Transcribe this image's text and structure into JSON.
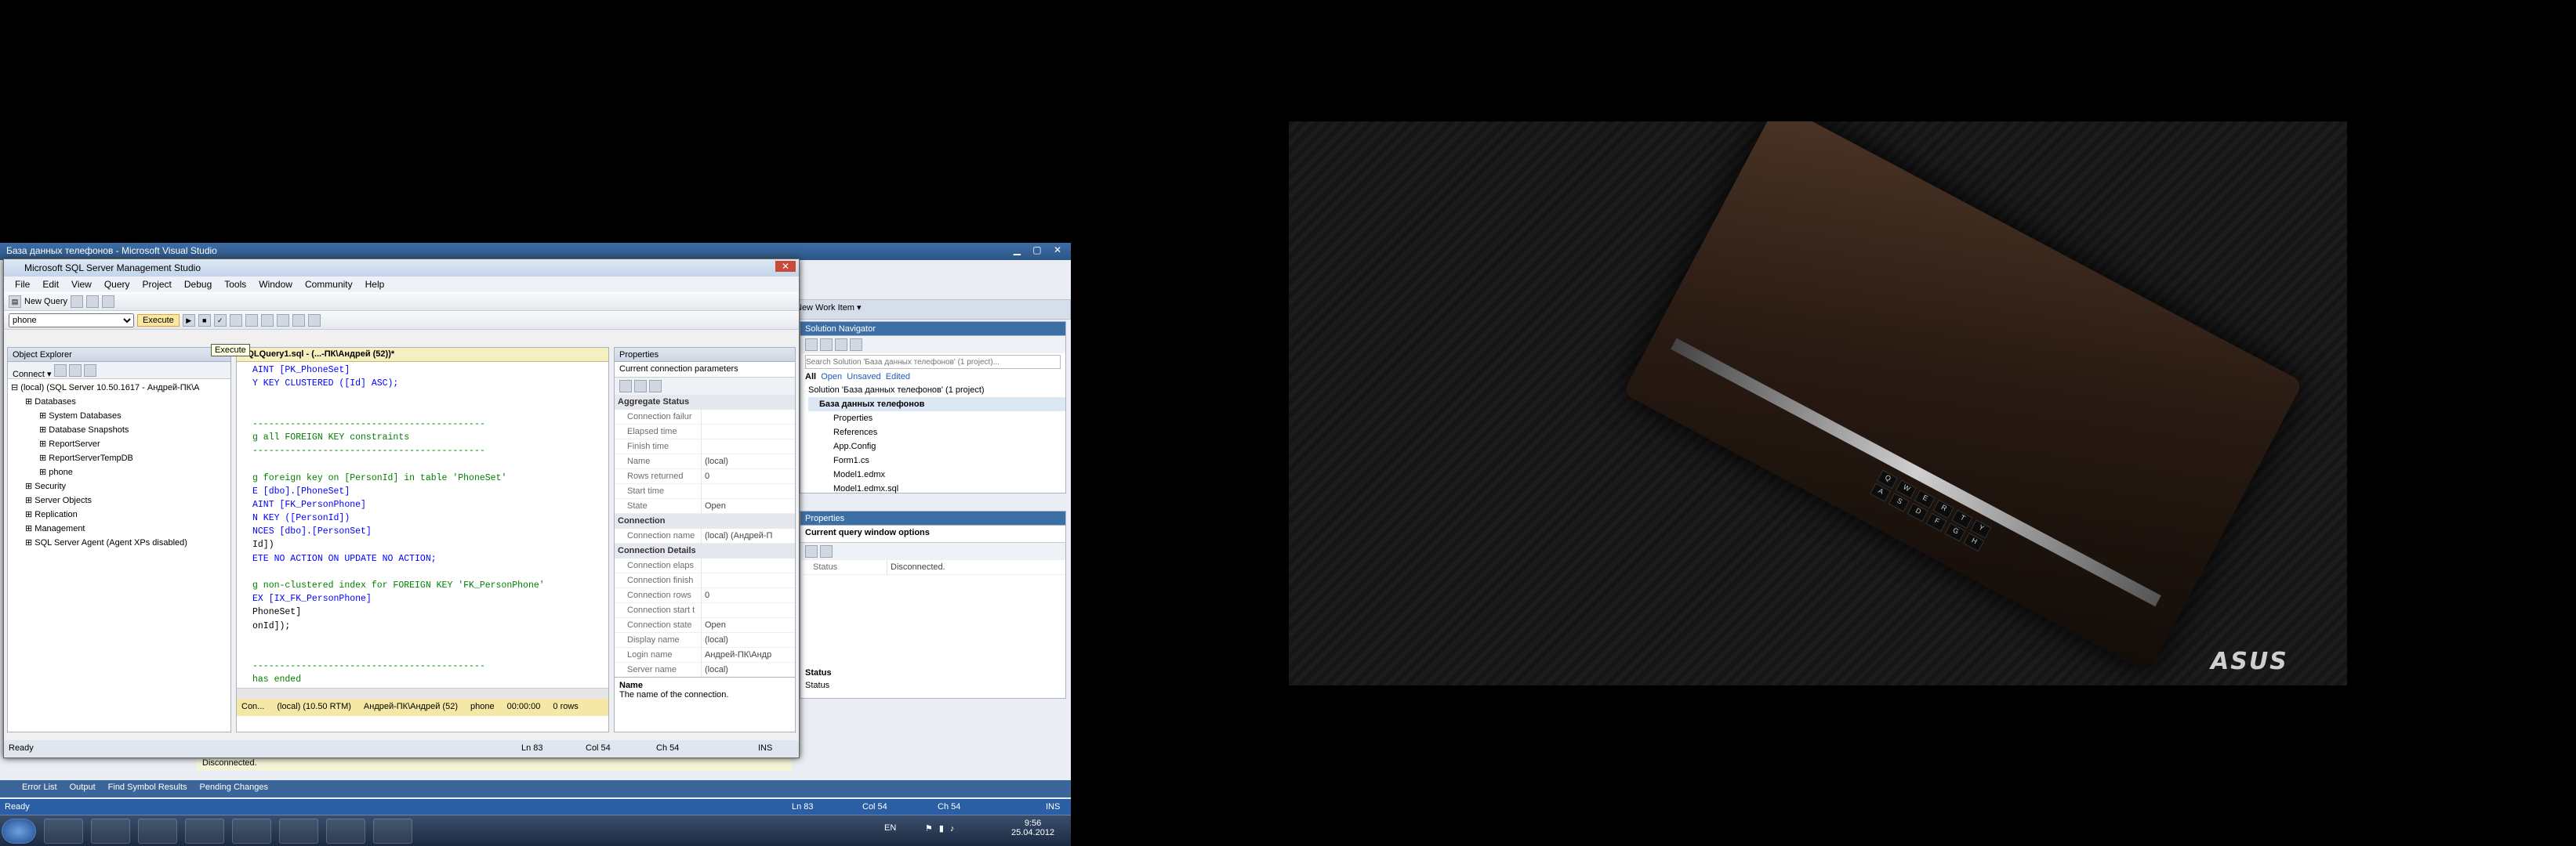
{
  "wallpaper": {
    "brand": "ASUS"
  },
  "vs": {
    "title": "База данных телефонов - Microsoft Visual Studio",
    "team_item": "New Work Item ▾",
    "bottom_tabs": [
      "Error List",
      "Output",
      "Find Symbol Results",
      "Pending Changes"
    ],
    "status": {
      "ready": "Ready",
      "ln": "Ln 83",
      "col": "Col 54",
      "ch": "Ch 54",
      "ins": "INS"
    },
    "disconnected": "Disconnected.",
    "status_label": "Status",
    "status_label2": "Status"
  },
  "solution": {
    "header": "Solution Navigator",
    "search_placeholder": "Search Solution 'База данных телефонов' (1 project)...",
    "filters": [
      "All",
      "Open",
      "Unsaved",
      "Edited"
    ],
    "items": [
      "Solution 'База данных телефонов' (1 project)",
      "База данных телефонов",
      "Properties",
      "References",
      "App.Config",
      "Form1.cs",
      "Model1.edmx",
      "Model1.edmx.sql"
    ]
  },
  "vs_properties": {
    "header": "Properties",
    "object": "Current query window options",
    "rows": [
      {
        "k": "Status",
        "v": "Disconnected."
      }
    ]
  },
  "ssms": {
    "title": "Microsoft SQL Server Management Studio",
    "menu": [
      "File",
      "Edit",
      "View",
      "Query",
      "Project",
      "Debug",
      "Tools",
      "Window",
      "Community",
      "Help"
    ],
    "new_query": "New Query",
    "database": "phone",
    "execute": "Execute",
    "tooltip": "Execute"
  },
  "object_explorer": {
    "header": "Object Explorer",
    "connect": "Connect ▾",
    "nodes": [
      {
        "label": "(local) (SQL Server 10.50.1617 - Андрей-ПК\\А",
        "indent": 0
      },
      {
        "label": "Databases",
        "indent": 1
      },
      {
        "label": "System Databases",
        "indent": 2
      },
      {
        "label": "Database Snapshots",
        "indent": 2
      },
      {
        "label": "ReportServer",
        "indent": 2
      },
      {
        "label": "ReportServerTempDB",
        "indent": 2
      },
      {
        "label": "phone",
        "indent": 2
      },
      {
        "label": "Security",
        "indent": 1
      },
      {
        "label": "Server Objects",
        "indent": 1
      },
      {
        "label": "Replication",
        "indent": 1
      },
      {
        "label": "Management",
        "indent": 1
      },
      {
        "label": "SQL Server Agent (Agent XPs disabled)",
        "indent": 1
      }
    ]
  },
  "editor": {
    "tab": "SQLQuery1.sql - (...-ПК\\Андрей (52))*",
    "lines": [
      {
        "t": "AINT [PK_PhoneSet]",
        "c": "blue"
      },
      {
        "t": "Y KEY CLUSTERED ([Id] ASC);",
        "c": "blue"
      },
      {
        "t": "",
        "c": ""
      },
      {
        "t": "",
        "c": ""
      },
      {
        "t": "-------------------------------------------",
        "c": "green"
      },
      {
        "t": "g all FOREIGN KEY constraints",
        "c": "green"
      },
      {
        "t": "-------------------------------------------",
        "c": "green"
      },
      {
        "t": "",
        "c": ""
      },
      {
        "t": "g foreign key on [PersonId] in table 'PhoneSet'",
        "c": "green"
      },
      {
        "t": "E [dbo].[PhoneSet]",
        "c": "blue"
      },
      {
        "t": "AINT [FK_PersonPhone]",
        "c": "blue"
      },
      {
        "t": "N KEY ([PersonId])",
        "c": "blue"
      },
      {
        "t": "NCES [dbo].[PersonSet]",
        "c": "blue"
      },
      {
        "t": "Id])",
        "c": ""
      },
      {
        "t": "ETE NO ACTION ON UPDATE NO ACTION;",
        "c": "blue"
      },
      {
        "t": "",
        "c": ""
      },
      {
        "t": "g non-clustered index for FOREIGN KEY 'FK_PersonPhone'",
        "c": "green"
      },
      {
        "t": "EX [IX_FK_PersonPhone]",
        "c": "blue"
      },
      {
        "t": "PhoneSet]",
        "c": ""
      },
      {
        "t": "onId]);",
        "c": ""
      },
      {
        "t": "",
        "c": ""
      },
      {
        "t": "",
        "c": ""
      },
      {
        "t": "-------------------------------------------",
        "c": "green"
      },
      {
        "t": "has ended",
        "c": "green"
      },
      {
        "t": "-------------------------------------------",
        "c": "green"
      }
    ],
    "statusbar": [
      "Con...",
      "(local) (10.50 RTM)",
      "Андрей-ПК\\Андрей (52)",
      "phone",
      "00:00:00",
      "0 rows"
    ]
  },
  "props": {
    "header": "Properties",
    "object": "Current connection parameters",
    "sections": [
      {
        "name": "Aggregate Status",
        "rows": [
          [
            "Connection failur",
            ""
          ],
          [
            "Elapsed time",
            ""
          ],
          [
            "Finish time",
            ""
          ],
          [
            "Name",
            "(local)"
          ],
          [
            "Rows returned",
            "0"
          ],
          [
            "Start time",
            ""
          ],
          [
            "State",
            "Open"
          ]
        ]
      },
      {
        "name": "Connection",
        "rows": [
          [
            "Connection name",
            "(local) (Андрей-П"
          ]
        ]
      },
      {
        "name": "Connection Details",
        "rows": [
          [
            "Connection elaps",
            ""
          ],
          [
            "Connection finish",
            ""
          ],
          [
            "Connection rows",
            "0"
          ],
          [
            "Connection start t",
            ""
          ],
          [
            "Connection state",
            "Open"
          ],
          [
            "Display name",
            "(local)"
          ],
          [
            "Login name",
            "Андрей-ПК\\Андр"
          ],
          [
            "Server name",
            "(local)"
          ]
        ]
      }
    ],
    "desc_title": "Name",
    "desc_text": "The name of the connection."
  },
  "ssms_status": {
    "ready": "Ready",
    "ln": "Ln 83",
    "col": "Col 54",
    "ch": "Ch 54",
    "ins": "INS"
  },
  "taskbar": {
    "lang": "EN",
    "time": "9:56",
    "date": "25.04.2012"
  }
}
